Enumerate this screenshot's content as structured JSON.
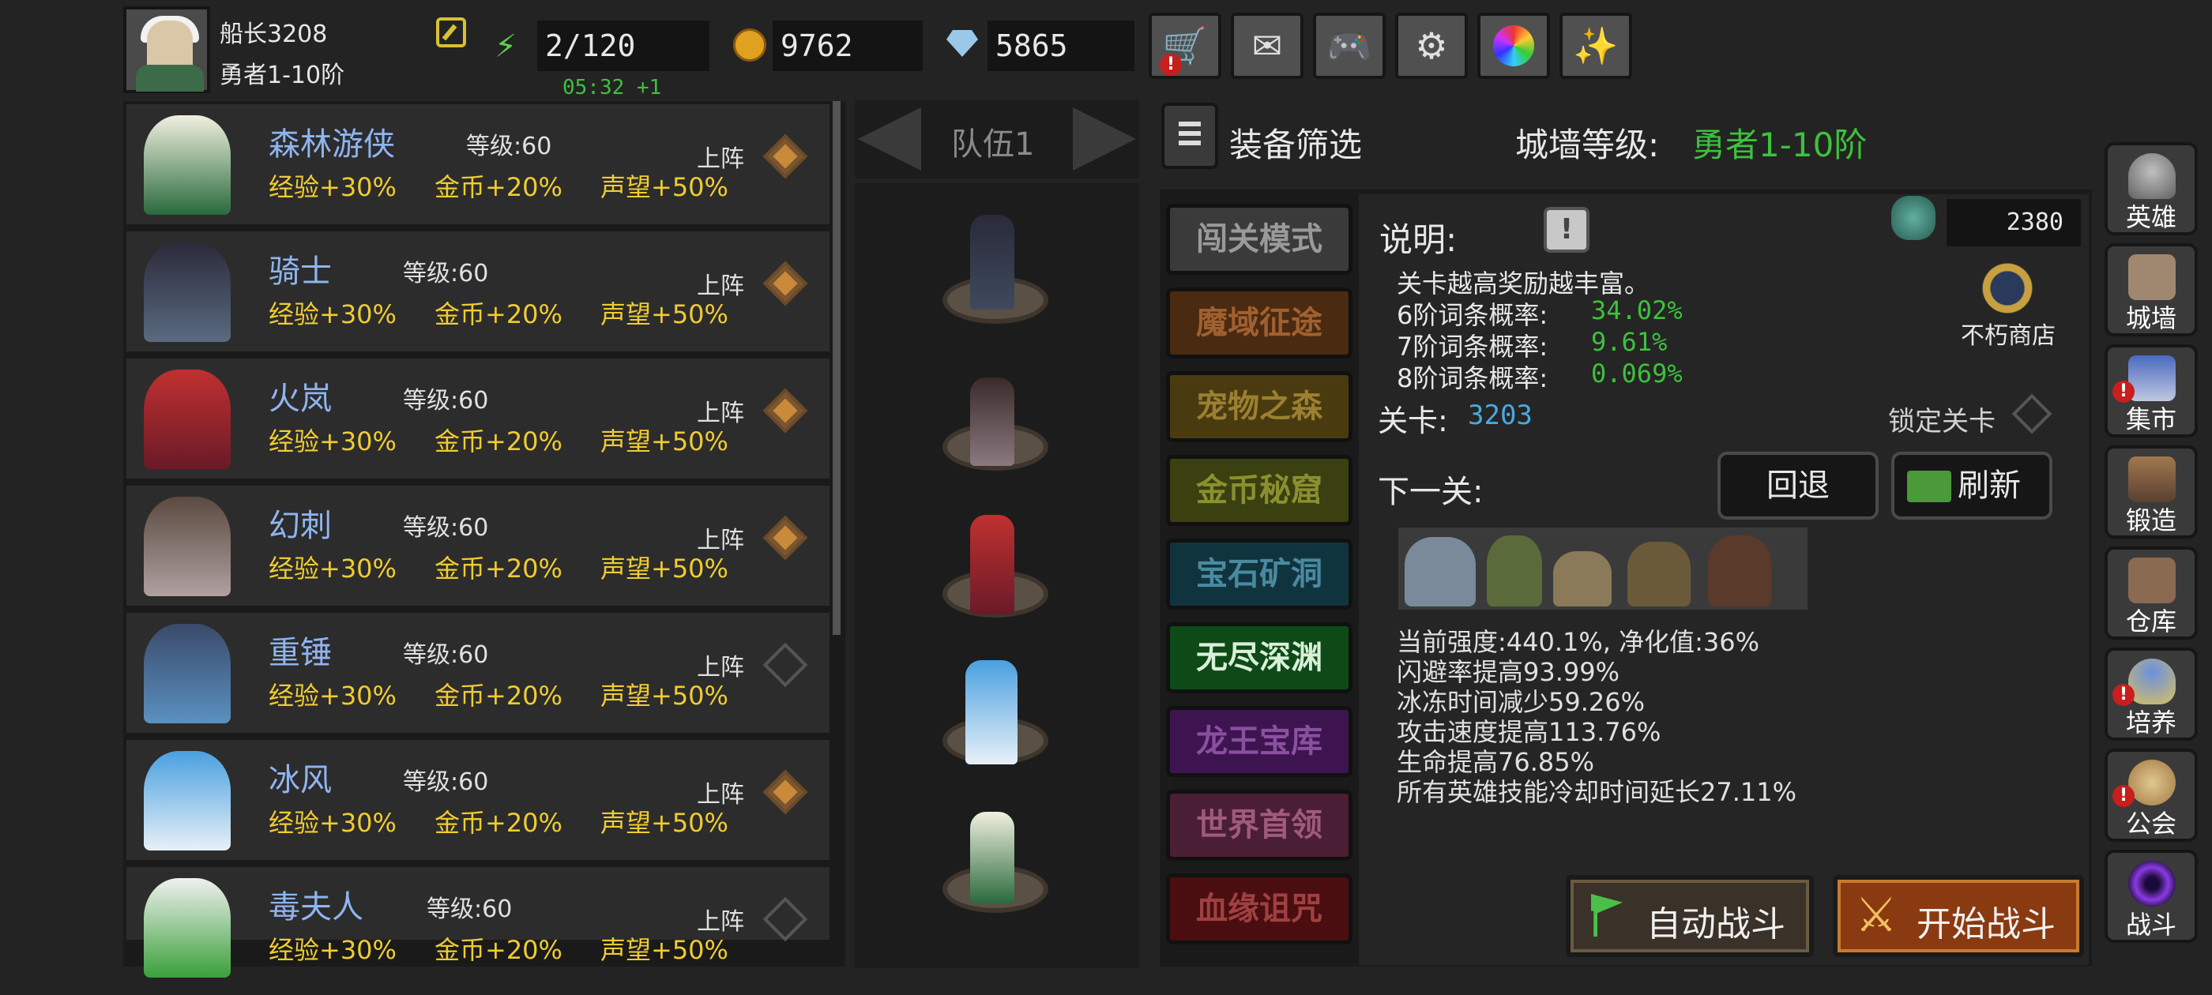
{
  "player": {
    "name": "船长3208",
    "rank": "勇者1-10阶"
  },
  "resources": {
    "energy": "2/120",
    "energy_timer": "05:32 +1",
    "gold": "9762",
    "gems": "5865"
  },
  "heroes": [
    {
      "name": "森林游侠",
      "level": "等级:60",
      "exp": "经验+30%",
      "gold": "金币+20%",
      "fame": "声望+50%",
      "deploy": "上阵",
      "deployed": true
    },
    {
      "name": "骑士",
      "level": "等级:60",
      "exp": "经验+30%",
      "gold": "金币+20%",
      "fame": "声望+50%",
      "deploy": "上阵",
      "deployed": true
    },
    {
      "name": "火岚",
      "level": "等级:60",
      "exp": "经验+30%",
      "gold": "金币+20%",
      "fame": "声望+50%",
      "deploy": "上阵",
      "deployed": true
    },
    {
      "name": "幻刺",
      "level": "等级:60",
      "exp": "经验+30%",
      "gold": "金币+20%",
      "fame": "声望+50%",
      "deploy": "上阵",
      "deployed": true
    },
    {
      "name": "重锤",
      "level": "等级:60",
      "exp": "经验+30%",
      "gold": "金币+20%",
      "fame": "声望+50%",
      "deploy": "上阵",
      "deployed": false
    },
    {
      "name": "冰风",
      "level": "等级:60",
      "exp": "经验+30%",
      "gold": "金币+20%",
      "fame": "声望+50%",
      "deploy": "上阵",
      "deployed": true
    },
    {
      "name": "毒夫人",
      "level": "等级:60",
      "exp": "经验+30%",
      "gold": "金币+20%",
      "fame": "声望+50%",
      "deploy": "上阵",
      "deployed": false
    }
  ],
  "team": {
    "label": "队伍1"
  },
  "filter": {
    "label": "装备筛选",
    "wall_label": "城墙等级:",
    "wall_value": "勇者1-10阶"
  },
  "modes": [
    "闯关模式",
    "魔域征途",
    "宠物之森",
    "金币秘窟",
    "宝石矿洞",
    "无尽深渊",
    "龙王宝库",
    "世界首领",
    "血缘诅咒"
  ],
  "stage": {
    "desc_label": "说明:",
    "desc_text": "关卡越高奖励越丰富。",
    "prob6_label": "6阶词条概率:",
    "prob6": "34.02%",
    "prob7_label": "7阶词条概率:",
    "prob7": "9.61%",
    "prob8_label": "8阶词条概率:",
    "prob8": "0.069%",
    "stage_label": "关卡:",
    "stage_value": "3203",
    "lock_label": "锁定关卡",
    "next_label": "下一关:",
    "back_label": "回退",
    "refresh_label": "刷新",
    "shop_count": "2380",
    "shop_label": "不朽商店",
    "stats": [
      "当前强度:440.1%, 净化值:36%",
      "闪避率提高93.99%",
      "冰冻时间减少59.26%",
      "攻击速度提高113.76%",
      "生命提高76.85%",
      "所有英雄技能冷却时间延长27.11%"
    ],
    "auto_battle": "自动战斗",
    "start_battle": "开始战斗"
  },
  "side_nav": [
    "英雄",
    "城墙",
    "集市",
    "锻造",
    "仓库",
    "培养",
    "公会",
    "战斗"
  ],
  "colors": {
    "bg": "#232323",
    "accent_green": "#3cc23c",
    "gold_text": "#f0cc30",
    "name_blue": "#8fb4f0"
  }
}
